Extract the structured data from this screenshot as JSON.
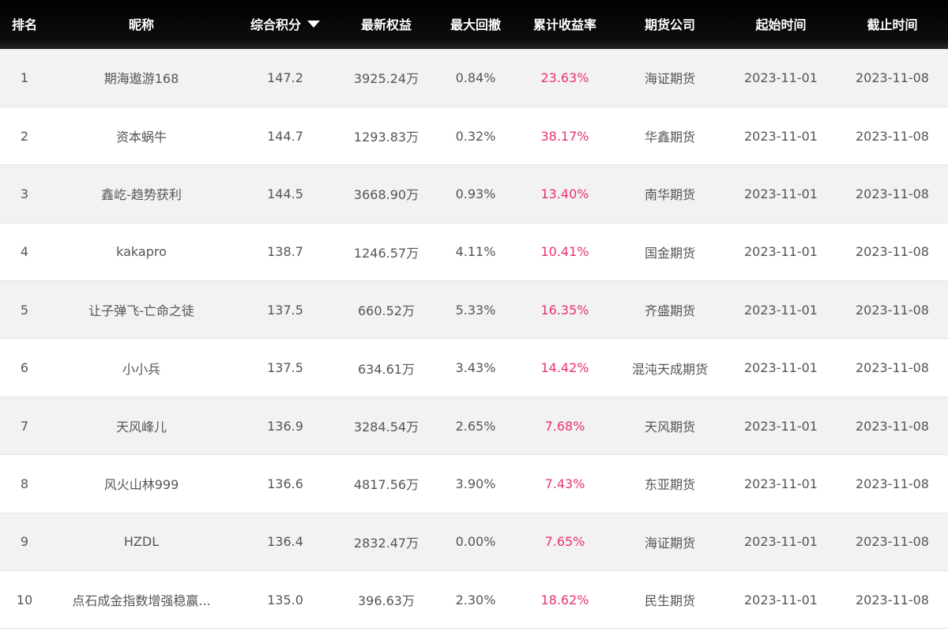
{
  "table": {
    "headers": {
      "rank": "排名",
      "nickname": "昵称",
      "score": "综合积分",
      "equity": "最新权益",
      "drawdown": "最大回撤",
      "return": "累计收益率",
      "firm": "期货公司",
      "start": "起始时间",
      "end": "截止时间"
    },
    "sort_icon": "caret-down-icon",
    "colors": {
      "header_bg": "#000000",
      "return_text": "#e8336d",
      "row_alt_bg": "#f2f2f2"
    },
    "rows": [
      {
        "rank": "1",
        "nickname": "期海遨游168",
        "score": "147.2",
        "equity": "3925.24万",
        "drawdown": "0.84%",
        "return": "23.63%",
        "firm": "海证期货",
        "start": "2023-11-01",
        "end": "2023-11-08"
      },
      {
        "rank": "2",
        "nickname": "资本蜗牛",
        "score": "144.7",
        "equity": "1293.83万",
        "drawdown": "0.32%",
        "return": "38.17%",
        "firm": "华鑫期货",
        "start": "2023-11-01",
        "end": "2023-11-08"
      },
      {
        "rank": "3",
        "nickname": "鑫屹-趋势获利",
        "score": "144.5",
        "equity": "3668.90万",
        "drawdown": "0.93%",
        "return": "13.40%",
        "firm": "南华期货",
        "start": "2023-11-01",
        "end": "2023-11-08"
      },
      {
        "rank": "4",
        "nickname": "kakapro",
        "score": "138.7",
        "equity": "1246.57万",
        "drawdown": "4.11%",
        "return": "10.41%",
        "firm": "国金期货",
        "start": "2023-11-01",
        "end": "2023-11-08"
      },
      {
        "rank": "5",
        "nickname": "让子弹飞-亡命之徒",
        "score": "137.5",
        "equity": "660.52万",
        "drawdown": "5.33%",
        "return": "16.35%",
        "firm": "齐盛期货",
        "start": "2023-11-01",
        "end": "2023-11-08"
      },
      {
        "rank": "6",
        "nickname": "小小兵",
        "score": "137.5",
        "equity": "634.61万",
        "drawdown": "3.43%",
        "return": "14.42%",
        "firm": "混沌天成期货",
        "start": "2023-11-01",
        "end": "2023-11-08"
      },
      {
        "rank": "7",
        "nickname": "天风峰儿",
        "score": "136.9",
        "equity": "3284.54万",
        "drawdown": "2.65%",
        "return": "7.68%",
        "firm": "天风期货",
        "start": "2023-11-01",
        "end": "2023-11-08"
      },
      {
        "rank": "8",
        "nickname": "风火山林999",
        "score": "136.6",
        "equity": "4817.56万",
        "drawdown": "3.90%",
        "return": "7.43%",
        "firm": "东亚期货",
        "start": "2023-11-01",
        "end": "2023-11-08"
      },
      {
        "rank": "9",
        "nickname": "HZDL",
        "score": "136.4",
        "equity": "2832.47万",
        "drawdown": "0.00%",
        "return": "7.65%",
        "firm": "海证期货",
        "start": "2023-11-01",
        "end": "2023-11-08"
      },
      {
        "rank": "10",
        "nickname": "点石成金指数增强稳赢...",
        "score": "135.0",
        "equity": "396.63万",
        "drawdown": "2.30%",
        "return": "18.62%",
        "firm": "民生期货",
        "start": "2023-11-01",
        "end": "2023-11-08"
      }
    ]
  }
}
